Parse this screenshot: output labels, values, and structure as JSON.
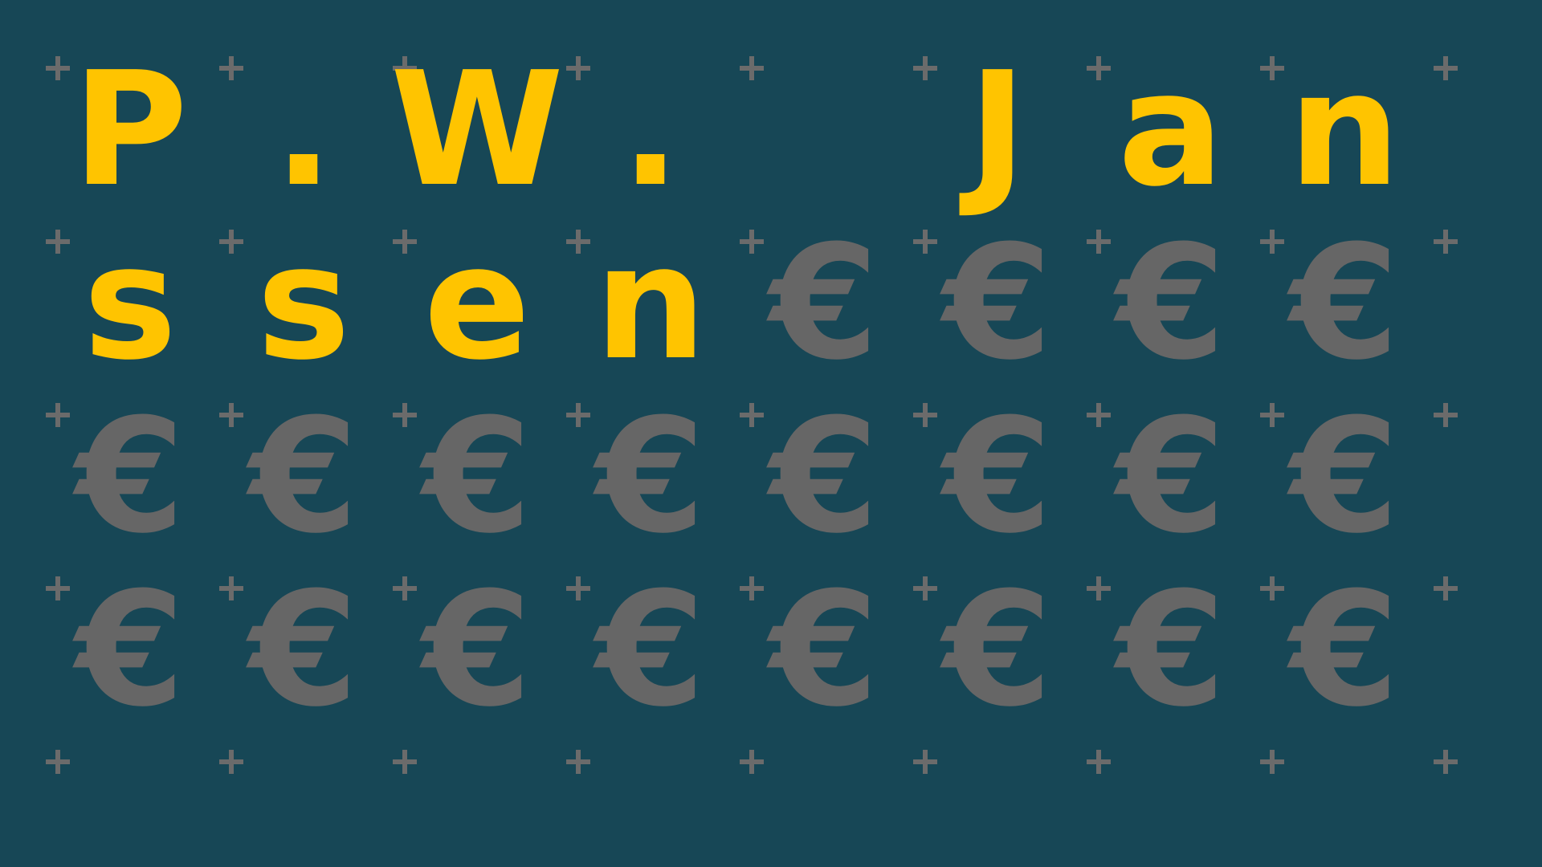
{
  "colors": {
    "background": "#174756",
    "name_letter": "#FFC400",
    "filler_symbol": "#666666",
    "grid_plus": "#6b6b6b"
  },
  "grid": {
    "columns": 8,
    "rows": 4
  },
  "name_letters": [
    "P",
    ".",
    "W",
    ".",
    "",
    "J",
    "a",
    "n",
    "s",
    "s",
    "e",
    "n"
  ],
  "filler_symbol": "€",
  "plus_icon": "plus-icon"
}
